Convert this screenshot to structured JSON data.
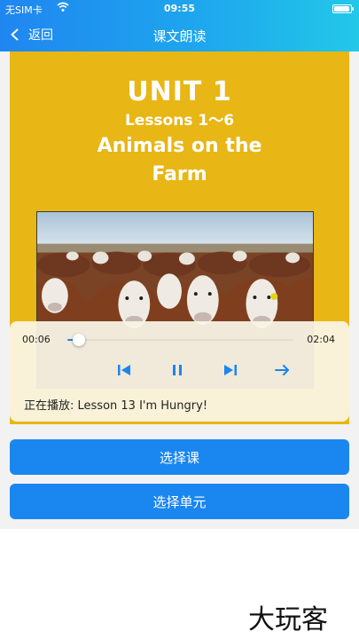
{
  "status_bar": {
    "carrier": "无SIM卡",
    "time": "09:55",
    "battery_level": 0.95
  },
  "nav": {
    "back_label": "返回",
    "title": "课文朗读"
  },
  "cover": {
    "unit": "UNIT 1",
    "lessons": "Lessons 1～6",
    "title_line1": "Animals on the",
    "title_line2": "Farm"
  },
  "player": {
    "current_time": "00:06",
    "duration": "02:04",
    "progress": 0.05,
    "now_playing": "正在播放: Lesson 13 I'm Hungry!",
    "controls": [
      "previous-icon",
      "pause-icon",
      "next-icon",
      "loop-arrow-icon"
    ]
  },
  "buttons": {
    "select_lesson": "选择课",
    "select_unit": "选择单元"
  },
  "watermark": "大玩客",
  "colors": {
    "header_start": "#1f86f0",
    "header_end": "#22c8e8",
    "accent": "#1a86f0",
    "cover_bg": "#e8b615"
  }
}
